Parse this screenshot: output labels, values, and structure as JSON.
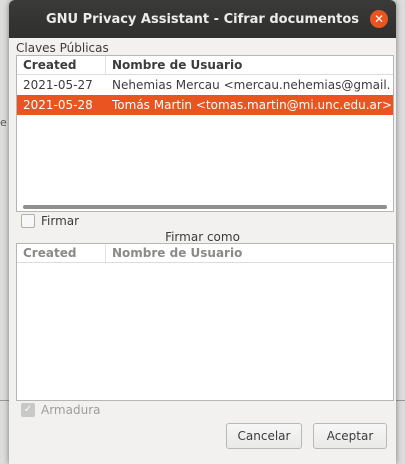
{
  "window": {
    "title": "GNU Privacy Assistant - Cifrar documentos",
    "close_icon": "close-icon"
  },
  "background_fragment": "e",
  "public_keys": {
    "label": "Claves Públicas",
    "columns": [
      "Created",
      "Nombre de Usuario"
    ],
    "rows": [
      {
        "created": "2021-05-27",
        "user": "Nehemias Mercau <mercau.nehemias@gmail.",
        "selected": false
      },
      {
        "created": "2021-05-28",
        "user": "Tomás Martin <tomas.martin@mi.unc.edu.ar>",
        "selected": true
      }
    ]
  },
  "sign": {
    "label": "Firmar",
    "checked": false
  },
  "sign_as": {
    "label": "Firmar como",
    "columns": [
      "Created",
      "Nombre de Usuario"
    ],
    "rows": []
  },
  "armor": {
    "label": "Armadura",
    "checked": true,
    "enabled": false
  },
  "buttons": {
    "cancel": "Cancelar",
    "accept": "Aceptar"
  },
  "colors": {
    "accent": "#e95420",
    "titlebar": "#333331"
  }
}
